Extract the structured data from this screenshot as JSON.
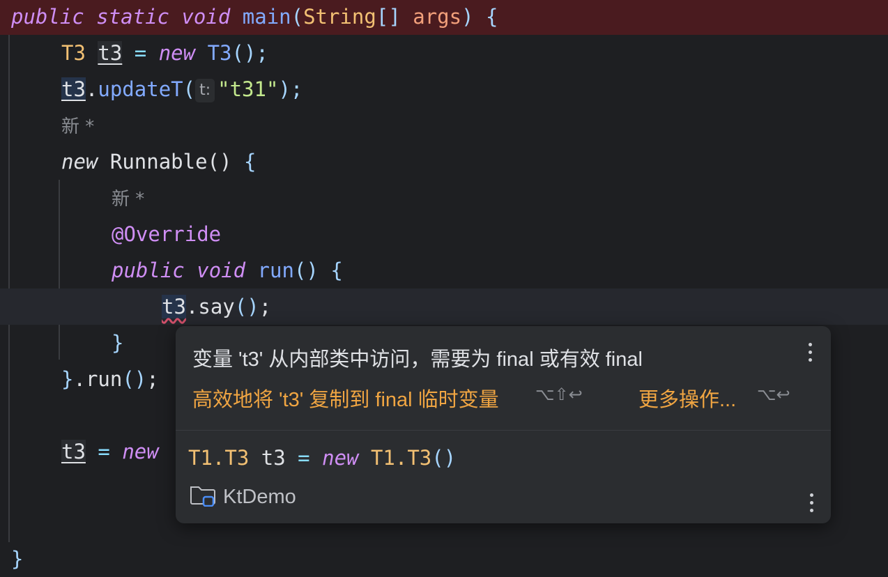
{
  "editor": {
    "lines": {
      "l1": {
        "kw1": "public",
        "kw2": "static",
        "kw3": "void",
        "fn": "main",
        "p1": "(",
        "ty": "String",
        "arr": "[]",
        "param": "args",
        "p2": ")",
        "brace": "{"
      },
      "l2": {
        "ty": "T3",
        "var": "t3",
        "eq": "=",
        "kw": "new",
        "ctor": "T3",
        "call": "();"
      },
      "l3": {
        "var": "t3",
        "dot": ".",
        "fn": "updateT",
        "p1": "(",
        "hint": "t:",
        "str": "\"t31\"",
        "end": ");"
      },
      "l4": {
        "hint": "新 *"
      },
      "l5": {
        "kw": "new",
        "ty": "Runnable",
        "p": "()",
        "brace": "{"
      },
      "l6": {
        "hint": "新 *"
      },
      "l7": {
        "ann": "@Override"
      },
      "l8": {
        "kw1": "public",
        "kw2": "void",
        "fn": "run",
        "p": "()",
        "brace": "{"
      },
      "l9": {
        "var": "t3",
        "dot": ".",
        "fn": "say",
        "p": "()",
        "end": ";"
      },
      "l10": {
        "brace": "}"
      },
      "l11": {
        "brace": "}",
        "dot": ".",
        "fn": "run",
        "p": "()",
        "end": ";"
      },
      "l12": {
        "var": "t3",
        "eq": "=",
        "kw": "new"
      },
      "l13": {
        "brace": "}"
      }
    }
  },
  "popup": {
    "message": "变量 't3' 从内部类中访问，需要为 final 或有效 final",
    "action": "高效地将 't3' 复制到 final 临时变量",
    "action_shortcut": "⌥⇧↩",
    "more": "更多操作...",
    "more_shortcut": "⌥↩",
    "decl": {
      "t1": "T1.T3",
      "var": "t3",
      "eq": "=",
      "kw": "new",
      "t2": "T1.T3",
      "p": "()"
    },
    "module": "KtDemo",
    "icons": {
      "folder": "module-folder-icon",
      "kebab": "more-vertical-icon"
    }
  },
  "colors": {
    "error_line": "#4a1b1f",
    "warning_text": "#f0a542",
    "background": "#1e1f22"
  }
}
